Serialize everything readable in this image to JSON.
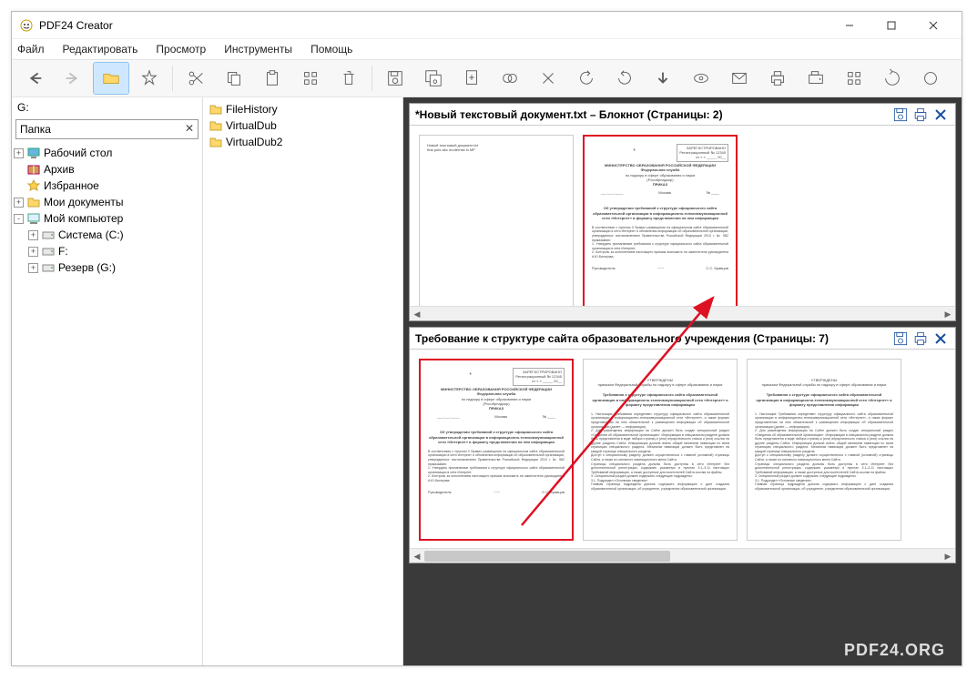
{
  "window": {
    "title": "PDF24 Creator"
  },
  "menubar": [
    "Файл",
    "Редактировать",
    "Просмотр",
    "Инструменты",
    "Помощь"
  ],
  "toolbar_left": [
    {
      "name": "back-icon",
      "glyph": "←"
    },
    {
      "name": "forward-icon",
      "glyph": "→",
      "disabled": true
    },
    {
      "name": "open-folder-icon",
      "glyph": "folder",
      "active": true
    },
    {
      "name": "favorite-icon",
      "glyph": "star"
    },
    {
      "sep": true
    },
    {
      "name": "cut-icon",
      "glyph": "scissors"
    },
    {
      "name": "copy-icon",
      "glyph": "copy"
    },
    {
      "name": "paste-icon",
      "glyph": "paste"
    },
    {
      "name": "grid-icon",
      "glyph": "grid"
    },
    {
      "name": "delete-icon",
      "glyph": "trash"
    }
  ],
  "toolbar_right": [
    {
      "name": "save-icon",
      "glyph": "save"
    },
    {
      "name": "save-all-icon",
      "glyph": "saveall"
    },
    {
      "name": "new-doc-icon",
      "glyph": "newdoc"
    },
    {
      "name": "merge-icon",
      "glyph": "merge"
    },
    {
      "name": "tool1-icon",
      "glyph": "wand"
    },
    {
      "name": "rotate-left-icon",
      "glyph": "rotl"
    },
    {
      "name": "rotate-right-icon",
      "glyph": "rotr"
    },
    {
      "name": "arrow-down-icon",
      "glyph": "down"
    },
    {
      "name": "preview-icon",
      "glyph": "eye"
    },
    {
      "name": "email-icon",
      "glyph": "mail"
    },
    {
      "name": "print-icon",
      "glyph": "print"
    },
    {
      "name": "fax-icon",
      "glyph": "fax"
    },
    {
      "name": "grid2-icon",
      "glyph": "grid"
    },
    {
      "name": "rotate-icon",
      "glyph": "rot"
    },
    {
      "name": "more-icon",
      "glyph": "circle"
    }
  ],
  "left": {
    "drive": "G:",
    "folder_label": "Папка",
    "tree": [
      {
        "level": 0,
        "exp": "+",
        "icon": "desktop",
        "label": "Рабочий стол"
      },
      {
        "level": 0,
        "exp": "",
        "icon": "archive",
        "label": "Архив"
      },
      {
        "level": 0,
        "exp": "",
        "icon": "favorites",
        "label": "Избранное"
      },
      {
        "level": 0,
        "exp": "+",
        "icon": "docs",
        "label": "Мои документы"
      },
      {
        "level": 0,
        "exp": "-",
        "icon": "computer",
        "label": "Мой компьютер"
      },
      {
        "level": 1,
        "exp": "+",
        "icon": "disk",
        "label": "Система (C:)"
      },
      {
        "level": 1,
        "exp": "+",
        "icon": "disk",
        "label": "F:"
      },
      {
        "level": 1,
        "exp": "+",
        "icon": "disk",
        "label": "Резерв (G:)"
      }
    ]
  },
  "mid": {
    "items": [
      {
        "icon": "folder",
        "label": "FileHistory"
      },
      {
        "icon": "folder",
        "label": "VirtualDub"
      },
      {
        "icon": "folder",
        "label": "VirtualDub2"
      }
    ]
  },
  "docs": [
    {
      "title": "*Новый текстовый документ.txt – Блокнот (Страницы: 2)",
      "pages": [
        {
          "sel": false,
          "variant": "simple"
        },
        {
          "sel": true,
          "variant": "order"
        }
      ]
    },
    {
      "title": "Требование к структуре сайта образовательного учреждения (Страницы: 7)",
      "pages": [
        {
          "sel": true,
          "variant": "order"
        },
        {
          "sel": false,
          "variant": "text"
        },
        {
          "sel": false,
          "variant": "text"
        }
      ]
    }
  ],
  "watermark": "PDF24.ORG"
}
